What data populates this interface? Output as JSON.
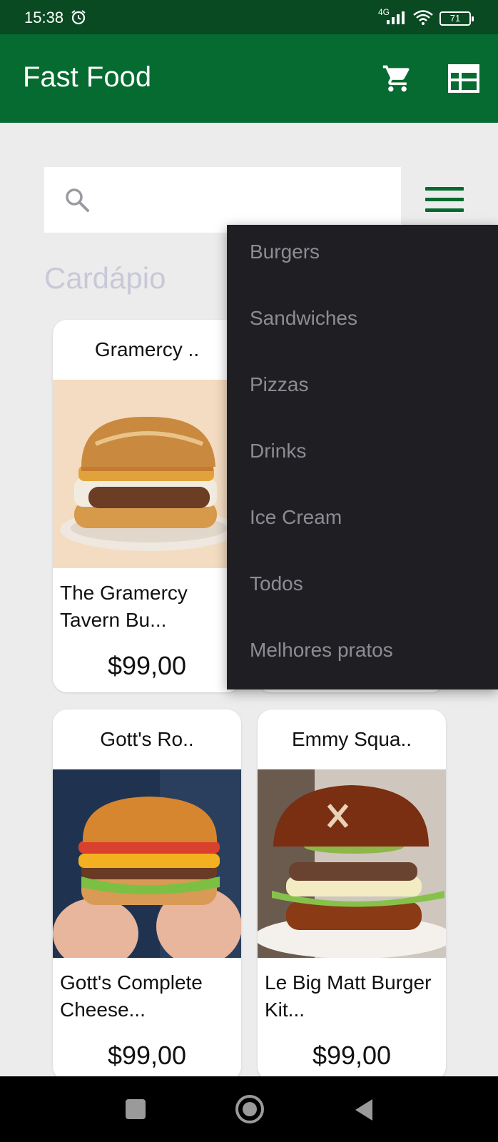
{
  "status_bar": {
    "time": "15:38",
    "network": "4G",
    "battery": "71",
    "icons": [
      "alarm-icon",
      "signal-icon",
      "wifi-icon",
      "battery-icon"
    ]
  },
  "app_bar": {
    "title": "Fast Food",
    "background": "#056b30",
    "icons": [
      "cart-icon",
      "table-icon"
    ]
  },
  "search": {
    "placeholder": "",
    "value": ""
  },
  "section_title": "Cardápio",
  "menu_dropdown": {
    "items": [
      "Burgers",
      "Sandwiches",
      "Pizzas",
      "Drinks",
      "Ice Cream",
      "Todos",
      "Melhores pratos"
    ]
  },
  "products": [
    {
      "title": "Gramercy ..",
      "name": "The Gramercy Tavern Bu...",
      "price": "$99,00"
    },
    {
      "title": "",
      "name": "",
      "price": ""
    },
    {
      "title": "Gott's Ro..",
      "name": "Gott's Complete Cheese...",
      "price": "$99,00"
    },
    {
      "title": "Emmy Squa..",
      "name": "Le Big Matt Burger Kit...",
      "price": "$99,00"
    }
  ],
  "nav_bar": {
    "icons": [
      "recents-icon",
      "home-icon",
      "back-icon"
    ]
  }
}
